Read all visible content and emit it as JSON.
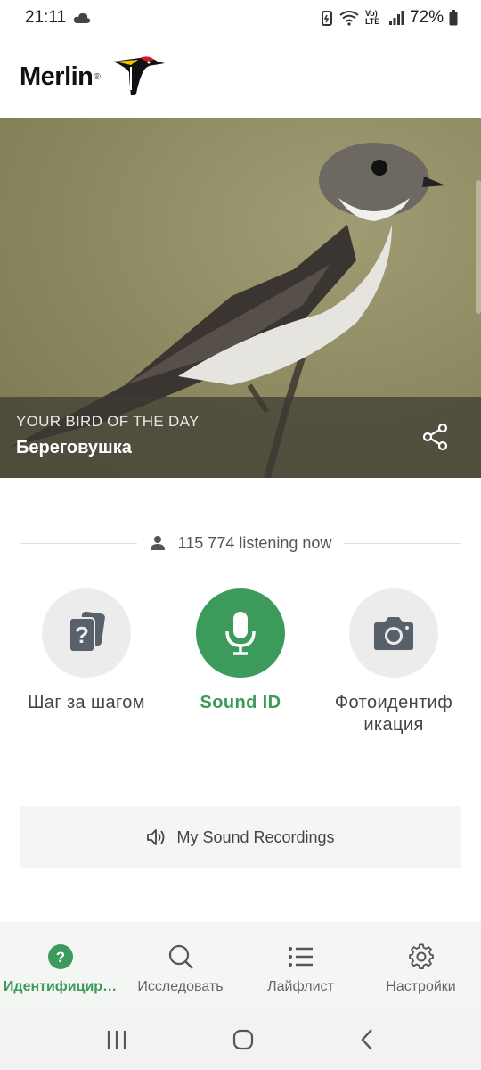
{
  "status_bar": {
    "time": "21:11",
    "network_label": "Vo) LTE",
    "battery": "72%"
  },
  "header": {
    "logo_text": "Merlin",
    "logo_mark": "®"
  },
  "hero": {
    "eyebrow": "YOUR BIRD OF THE DAY",
    "bird_name": "Береговушка"
  },
  "listening": {
    "text": "115 774 listening now"
  },
  "id_methods": [
    {
      "label": "Шаг за шагом",
      "icon": "question-cards-icon"
    },
    {
      "label": "Sound ID",
      "icon": "microphone-icon"
    },
    {
      "label": "Фотоидентиф икация",
      "icon": "camera-icon"
    }
  ],
  "recordings": {
    "label": "My Sound Recordings"
  },
  "bottom_nav": [
    {
      "label": "Идентифицир…",
      "icon": "help-circle-icon"
    },
    {
      "label": "Исследовать",
      "icon": "search-icon"
    },
    {
      "label": "Лайфлист",
      "icon": "list-icon"
    },
    {
      "label": "Настройки",
      "icon": "gear-icon"
    }
  ],
  "colors": {
    "accent": "#3c9a5a",
    "nav_bg": "#f4f6f4"
  }
}
